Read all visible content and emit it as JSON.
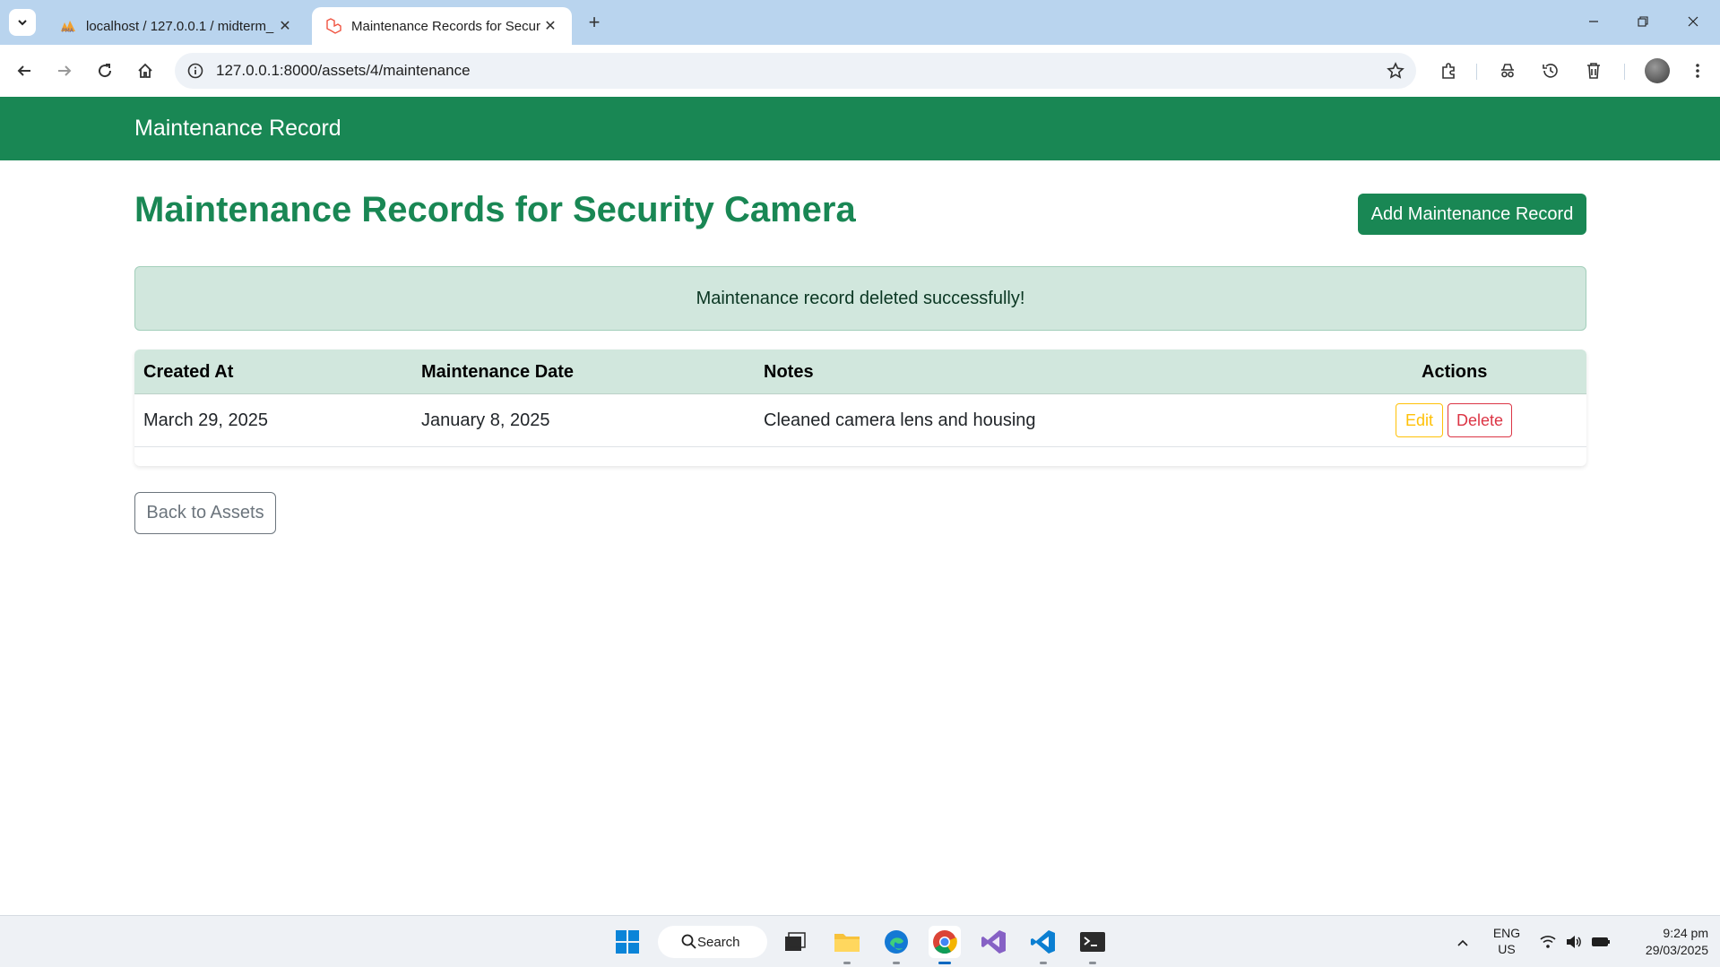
{
  "browser": {
    "tabs": [
      {
        "title": "localhost / 127.0.0.1 / midterm_",
        "active": false
      },
      {
        "title": "Maintenance Records for Securi",
        "active": true
      }
    ],
    "url": "127.0.0.1:8000/assets/4/maintenance"
  },
  "navbar": {
    "brand": "Maintenance Record"
  },
  "page": {
    "title": "Maintenance Records for Security Camera",
    "add_button": "Add Maintenance Record",
    "alert": "Maintenance record deleted successfully!",
    "table": {
      "headers": [
        "Created At",
        "Maintenance Date",
        "Notes",
        "Actions"
      ],
      "rows": [
        {
          "created_at": "March 29, 2025",
          "maintenance_date": "January 8, 2025",
          "notes": "Cleaned camera lens and housing",
          "edit": "Edit",
          "delete": "Delete"
        }
      ]
    },
    "back_button": "Back to Assets"
  },
  "taskbar": {
    "search": "Search",
    "lang": {
      "line1": "ENG",
      "line2": "US"
    },
    "time": "9:24 pm",
    "date": "29/03/2025"
  },
  "colors": {
    "primary": "#198754",
    "alert_bg": "#d1e7dd",
    "warning": "#ffc107",
    "danger": "#dc3545",
    "secondary": "#6c757d"
  }
}
